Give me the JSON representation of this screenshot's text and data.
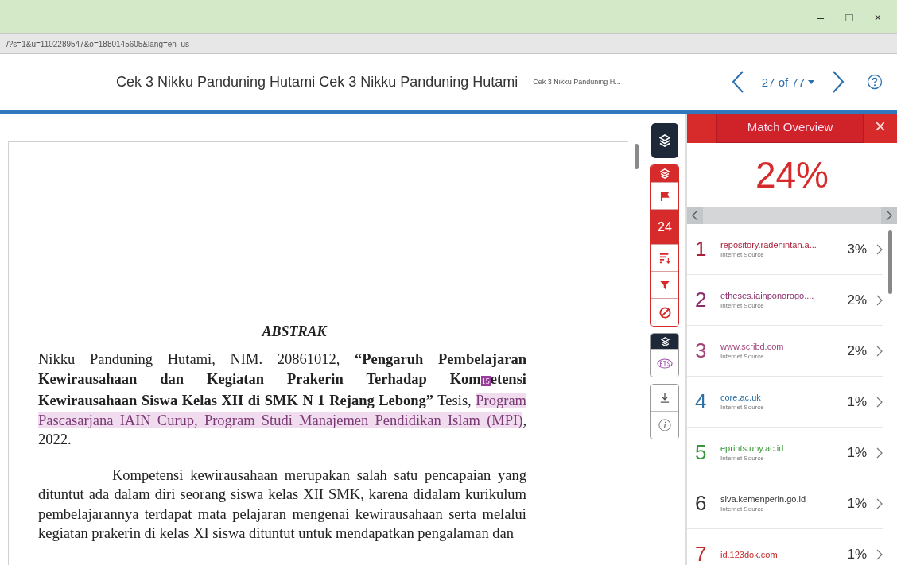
{
  "window": {
    "controls": [
      "–",
      "□",
      "×"
    ]
  },
  "address_bar": {
    "url": "/?s=1&u=1102289547&o=1880145605&lang=en_us"
  },
  "header": {
    "title": "Cek 3 Nikku Panduning Hutami Cek 3 Nikku Panduning Hutami",
    "subtitle": "Cek 3 Nikku Panduning H...",
    "page_nav": "27 of 77"
  },
  "document": {
    "heading": "ABSTRAK",
    "paragraphs": [
      {
        "indent": false,
        "segments": [
          {
            "kind": "normal",
            "text": "Nikku Panduning Hutami, NIM. 20861012, "
          },
          {
            "kind": "bold",
            "text": "“Pengaruh Pembelajaran Kewirausahaan dan Kegiatan Prakerin Terhadap Kom"
          },
          {
            "kind": "marker",
            "text": "15"
          },
          {
            "kind": "bold",
            "text": "etensi Kewirausahaan Siswa Kelas XII di SMK N 1 Rejang Lebong”"
          },
          {
            "kind": "normal",
            "text": " Tesis, "
          },
          {
            "kind": "highlight",
            "text": "Program Pascasarjana IAIN Curup, Program Studi Manajemen Pendidikan Islam (MPI)"
          },
          {
            "kind": "normal",
            "text": ", 2022."
          }
        ]
      },
      {
        "indent": true,
        "segments": [
          {
            "kind": "normal",
            "text": "Kompetensi kewirausahaan merupakan salah satu pencapaian yang dituntut  ada dalam diri seorang siswa kelas XII SMK, karena didalam kurikulum pembelajarannya terdapat mata pelajaran mengenai kewirausahaan serta melalui kegiatan prakerin di kelas XI siswa dituntut untuk mendapatkan pengalaman dan"
          }
        ]
      }
    ]
  },
  "toolbar": {
    "match_count": "24"
  },
  "match_overview": {
    "title": "Match Overview",
    "close": "×",
    "score": "24%",
    "matches": [
      {
        "number": "1",
        "source": "repository.radenintan.a...",
        "type": "Internet Source",
        "percent": "3%",
        "color": "#a8203a"
      },
      {
        "number": "2",
        "source": "etheses.iainponorogo....",
        "type": "Internet Source",
        "percent": "2%",
        "color": "#8a2c6c"
      },
      {
        "number": "3",
        "source": "www.scribd.com",
        "type": "Internet Source",
        "percent": "2%",
        "color": "#a04478"
      },
      {
        "number": "4",
        "source": "core.ac.uk",
        "type": "Internet Source",
        "percent": "1%",
        "color": "#2c70a4"
      },
      {
        "number": "5",
        "source": "eprints.uny.ac.id",
        "type": "Internet Source",
        "percent": "1%",
        "color": "#3a963a"
      },
      {
        "number": "6",
        "source": "siva.kemenperin.go.id",
        "type": "Internet Source",
        "percent": "1%",
        "color": "#333333"
      },
      {
        "number": "7",
        "source": "id.123dok.com",
        "percent": "1%",
        "color": "#c42a2a"
      }
    ]
  }
}
